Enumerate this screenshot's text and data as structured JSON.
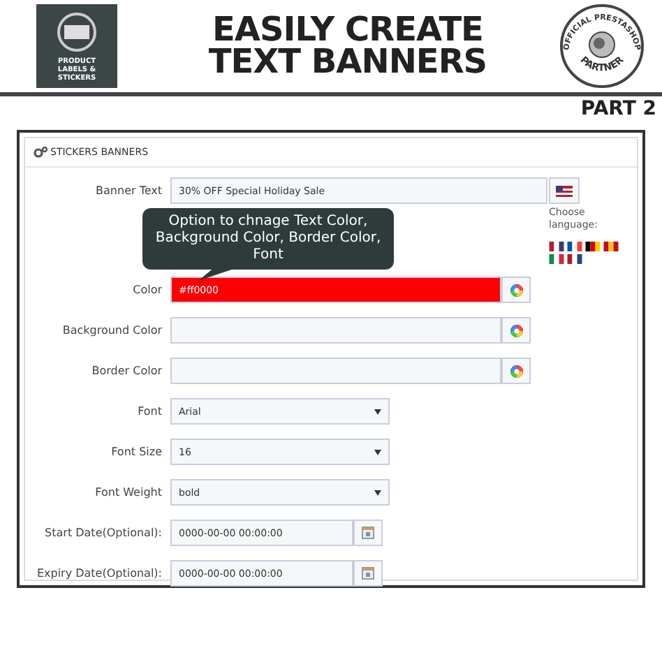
{
  "header": {
    "logo_text": "PRODUCT LABELS & STICKERS",
    "title_lines": [
      "EASILY CREATE",
      "TEXT BANNERS"
    ],
    "badge_top": "OFFICIAL PRESTASHOP",
    "badge_bottom": "PARTNER"
  },
  "part_label": "PART 2",
  "panel": {
    "title": "STICKERS BANNERS",
    "fields": [
      {
        "kind": "text",
        "label": "Banner Text",
        "value": "30% OFF Special Holiday Sale"
      },
      {
        "kind": "color",
        "label": "Color",
        "value": "#ff0000",
        "color": "#ff0000"
      },
      {
        "kind": "color",
        "label": "Background Color"
      },
      {
        "kind": "color",
        "label": "Border Color"
      },
      {
        "kind": "select",
        "label": "Font",
        "value": "Arial"
      },
      {
        "kind": "select",
        "label": "Font Size",
        "value": "16"
      },
      {
        "kind": "select",
        "label": "Font Weight",
        "value": "bold"
      },
      {
        "kind": "date",
        "label": "Start Date(Optional):",
        "value": "0000-00-00 00:00:00"
      },
      {
        "kind": "date",
        "label": "Expiry Date(Optional):",
        "value": "0000-00-00 00:00:00"
      }
    ],
    "language": {
      "label": "Choose language:"
    },
    "callout": "Option to chnage Text Color, Background Color, Border Color, Font"
  }
}
